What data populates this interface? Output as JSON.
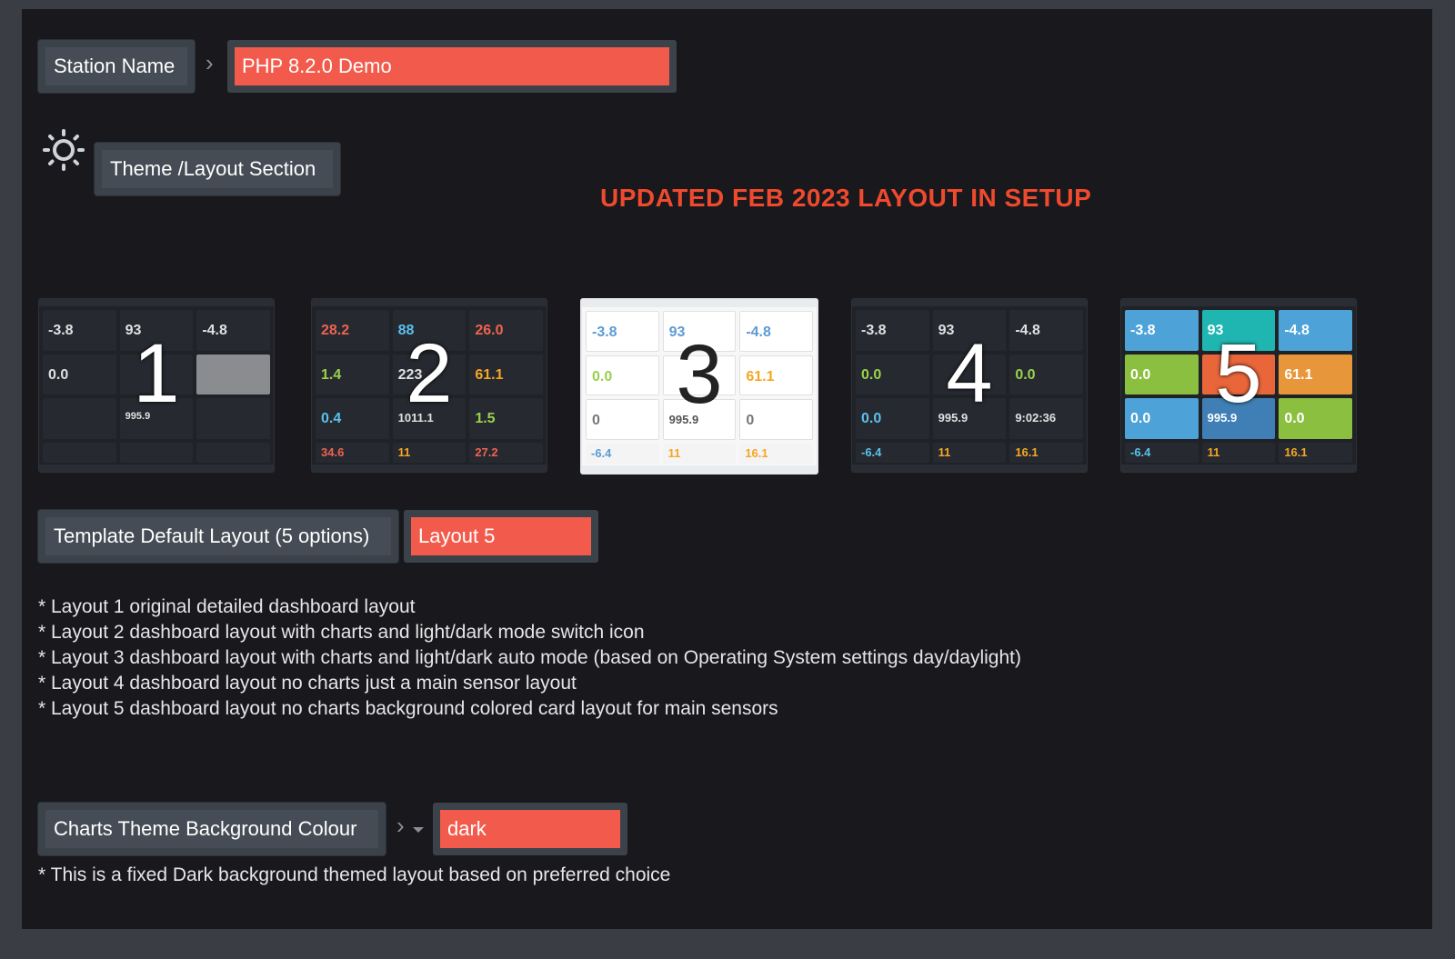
{
  "station": {
    "label": "Station Name",
    "value": "PHP 8.2.0 Demo"
  },
  "theme_section": {
    "icon": "sun-icon",
    "label": "Theme /Layout Section"
  },
  "headline": "UPDATED FEB 2023 LAYOUT IN SETUP",
  "layouts": [
    {
      "number": "1",
      "values": [
        "-3.8",
        "93",
        "-4.8",
        "0.0",
        "",
        "",
        "",
        "995.9",
        ""
      ],
      "bottom": [
        "",
        "",
        ""
      ]
    },
    {
      "number": "2",
      "values": [
        "28.2",
        "88",
        "26.0",
        "1.4",
        "223",
        "61.1",
        "0.4",
        "1011.1",
        "1.5"
      ],
      "bottom": [
        "34.6",
        "11",
        "27.2"
      ]
    },
    {
      "number": "3",
      "values": [
        "-3.8",
        "93",
        "-4.8",
        "0.0",
        "",
        "61.1",
        "0",
        "995.9",
        "0"
      ],
      "bottom": [
        "-6.4",
        "11",
        "16.1"
      ]
    },
    {
      "number": "4",
      "values": [
        "-3.8",
        "93",
        "-4.8",
        "0.0",
        "",
        "0.0",
        "0.0",
        "995.9",
        "9:02:36"
      ],
      "bottom": [
        "-6.4",
        "11",
        "16.1"
      ]
    },
    {
      "number": "5",
      "values": [
        "-3.8",
        "93",
        "-4.8",
        "0.0",
        "",
        "61.1",
        "0.0",
        "995.9",
        "0.0"
      ],
      "bottom": [
        "-6.4",
        "11",
        "16.1"
      ]
    }
  ],
  "template_layout": {
    "label": "Template Default Layout (5 options)",
    "value": "Layout 5"
  },
  "layout_descriptions": [
    "* Layout 1 original detailed dashboard layout",
    "* Layout 2 dashboard layout with charts and light/dark mode switch icon",
    "* Layout 3 dashboard layout with charts and light/dark auto mode (based on Operating System settings day/daylight)",
    "* Layout 4 dashboard layout no charts just a main sensor layout",
    "* Layout 5 dashboard layout no charts background colored card layout for main sensors"
  ],
  "charts_theme": {
    "label": "Charts Theme Background Colour",
    "value": "dark",
    "note": "* This is a fixed Dark background themed layout based on preferred choice"
  },
  "colors": {
    "accent": "#f25b4c",
    "headline": "#ef4a2d",
    "background": "#18181d"
  }
}
